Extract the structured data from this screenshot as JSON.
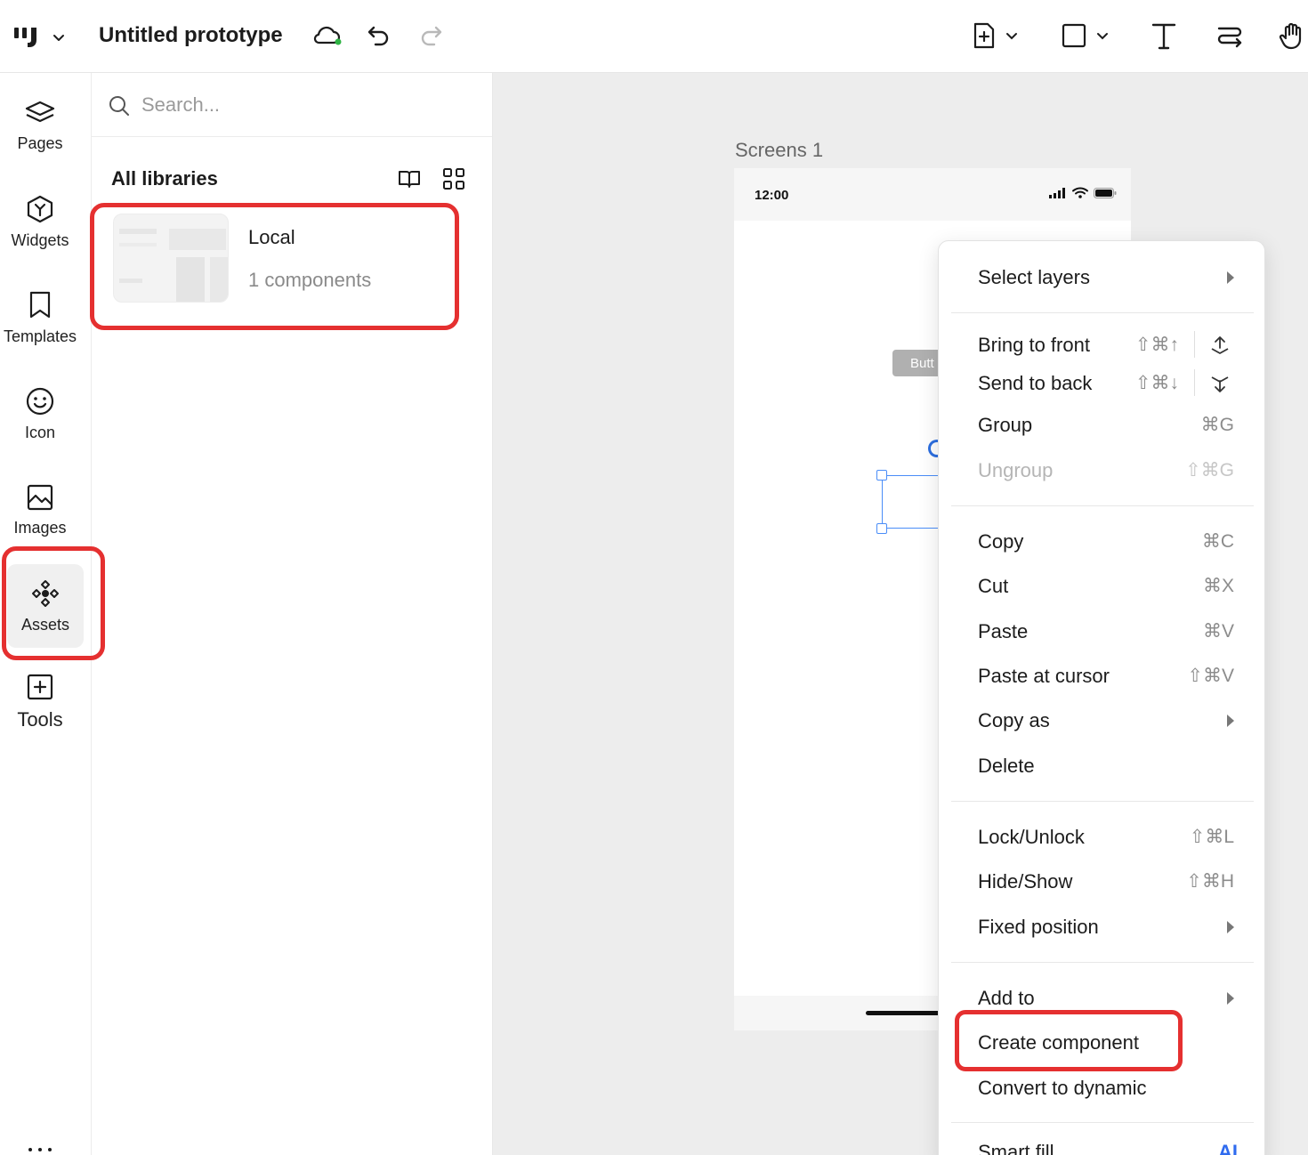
{
  "topbar": {
    "doc_title": "Untitled prototype",
    "icons": [
      "logo-icon",
      "chevron-down-icon",
      "cloud-sync-icon",
      "undo-icon",
      "redo-icon",
      "add-screen-icon",
      "rectangle-icon",
      "text-icon",
      "connector-icon",
      "hand-icon"
    ],
    "sync_status_color": "#2fb344"
  },
  "rail": {
    "items": [
      {
        "label": "Pages",
        "icon": "layers-icon"
      },
      {
        "label": "Widgets",
        "icon": "widgets-icon"
      },
      {
        "label": "Templates",
        "icon": "bookmark-icon"
      },
      {
        "label": "Icon",
        "icon": "smiley-icon"
      },
      {
        "label": "Images",
        "icon": "image-icon"
      },
      {
        "label": "Assets",
        "icon": "assets-icon",
        "active": true
      },
      {
        "label": "Tools",
        "icon": "plus-square-icon"
      }
    ]
  },
  "panel": {
    "search_placeholder": "Search...",
    "section_title": "All libraries",
    "library": {
      "name": "Local",
      "count": "1 components"
    }
  },
  "canvas": {
    "screen_label": "Screens 1",
    "status_time": "12:00",
    "button_chip": "Butt"
  },
  "menu": {
    "select_layers": "Select layers",
    "bring_to_front": {
      "label": "Bring to front",
      "shortcut": "⇧⌘↑"
    },
    "send_to_back": {
      "label": "Send to back",
      "shortcut": "⇧⌘↓"
    },
    "group": {
      "label": "Group",
      "shortcut": "⌘G"
    },
    "ungroup": {
      "label": "Ungroup",
      "shortcut": "⇧⌘G"
    },
    "copy": {
      "label": "Copy",
      "shortcut": "⌘C"
    },
    "cut": {
      "label": "Cut",
      "shortcut": "⌘X"
    },
    "paste": {
      "label": "Paste",
      "shortcut": "⌘V"
    },
    "paste_at_cursor": {
      "label": "Paste at cursor",
      "shortcut": "⇧⌘V"
    },
    "copy_as": "Copy as",
    "delete": "Delete",
    "lock_unlock": {
      "label": "Lock/Unlock",
      "shortcut": "⇧⌘L"
    },
    "hide_show": {
      "label": "Hide/Show",
      "shortcut": "⇧⌘H"
    },
    "fixed_position": "Fixed position",
    "add_to": "Add to",
    "create_component": "Create component",
    "convert_to_dynamic": "Convert to dynamic",
    "smart_fill": "Smart fill",
    "smart_fill_badge": "AI"
  },
  "colors": {
    "highlight": "#e53030",
    "selection": "#4a8df8",
    "ai_accent": "#2f6bef",
    "canvas_bg": "#ededed"
  }
}
